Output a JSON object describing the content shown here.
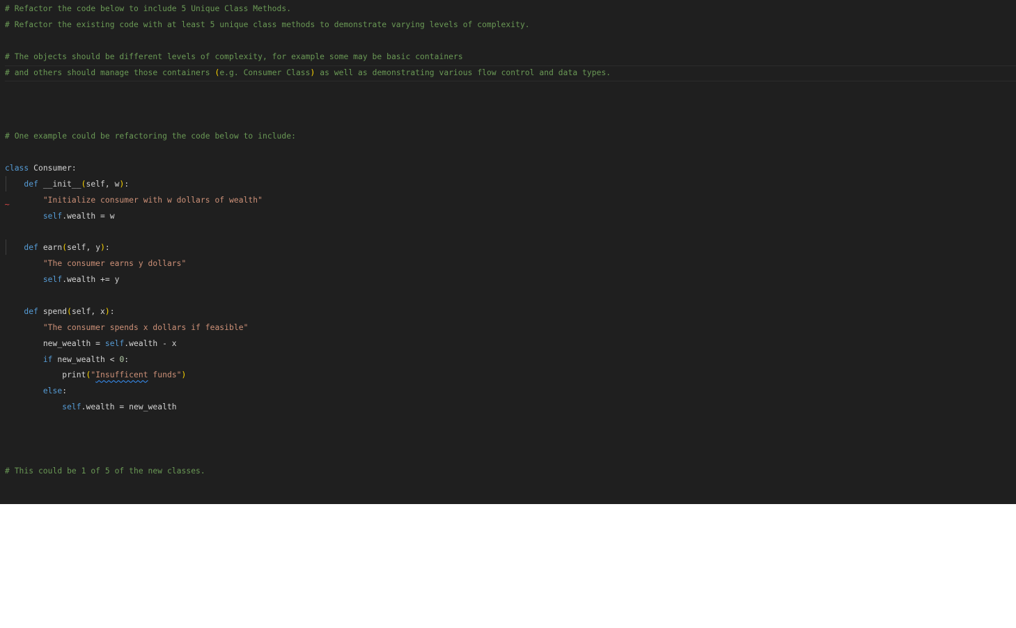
{
  "editor": {
    "language": "python",
    "colors": {
      "background": "#1f1f1f",
      "comment": "#6a9955",
      "keyword": "#569cd6",
      "string": "#ce9178",
      "number": "#b5cea8",
      "bracket": "#ffd700",
      "identifier": "#d4d4d4"
    },
    "lines": {
      "l1": "# Refactor the code below to include 5 Unique Class Methods.",
      "l2": "# Refactor the existing code with at least 5 unique class methods to demonstrate varying levels of complexity.",
      "l4": "# The objects should be different levels of complexity, for example some may be basic containers",
      "l5a": "# and others should manage those containers ",
      "l5b": "(",
      "l5c": "e.g. Consumer Class",
      "l5d": ")",
      "l5e": " as well as demonstrating various flow control and data types.",
      "l9": "# One example could be refactoring the code below to include:",
      "l11_kw": "class",
      "l11_name": " Consumer:",
      "l12_kw": "def",
      "l12_name": " __init__",
      "l12_args": "self, w",
      "l13_str": "\"Initialize consumer with w dollars of wealth\"",
      "l14_self": "self",
      "l14_rest": ".wealth = w",
      "l16_kw": "def",
      "l16_name": " earn",
      "l16_args": "self, y",
      "l17_str": "\"The consumer earns y dollars\"",
      "l18_self": "self",
      "l18_rest": ".wealth += y",
      "l20_kw": "def",
      "l20_name": " spend",
      "l20_args": "self, x",
      "l21_str": "\"The consumer spends x dollars if feasible\"",
      "l22_a": "new_wealth = ",
      "l22_self": "self",
      "l22_b": ".wealth - x",
      "l23_kw": "if",
      "l23_a": " new_wealth < ",
      "l23_num": "0",
      "l23_b": ":",
      "l24_fn": "print",
      "l24_q1": "\"",
      "l24_misspelled": "Insufficent",
      "l24_rest": " funds\"",
      "l25_kw": "else",
      "l25_b": ":",
      "l26_self": "self",
      "l26_rest": ".wealth = new_wealth",
      "l30": "# This could be 1 of 5 of the new classes."
    },
    "punct": {
      "open": "(",
      "close": ")",
      "colon": ":"
    },
    "gutter": {
      "error_marker": "~"
    }
  }
}
